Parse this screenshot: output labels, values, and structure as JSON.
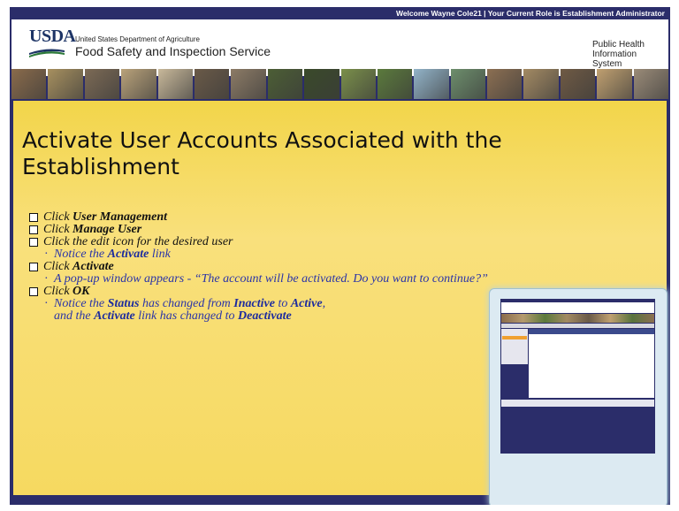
{
  "topbar": {
    "text": "Welcome Wayne Cole21  |  Your Current Role is Establishment Administrator"
  },
  "header": {
    "logo": "USDA",
    "department": "United States Department of Agriculture",
    "agency": "Food Safety and Inspection Service",
    "system_line1": "Public Health",
    "system_line2": "Information System"
  },
  "slide": {
    "title": "Activate User Accounts Associated with the Establishment",
    "steps": [
      {
        "prefix": "Click ",
        "bold": "User Management"
      },
      {
        "prefix": "Click ",
        "bold": "Manage User"
      },
      {
        "prefix": "Click the edit icon for the desired user"
      },
      {
        "sub1_a": "Notice the ",
        "sub1_b": "Activate",
        "sub1_c": " link"
      },
      {
        "prefix": "Click ",
        "bold": "Activate"
      },
      {
        "sub": "A pop-up window appears - “The account will be activated. Do you want to continue?”"
      },
      {
        "prefix": "Click ",
        "bold": "OK"
      },
      {
        "a": "Notice the ",
        "b": "Status",
        "c": " has changed from ",
        "d": "Inactive",
        "e": " to ",
        "f": "Active",
        "g": ",",
        "h": "and the ",
        "i": "Activate",
        "j": " link has changed to ",
        "k": "Deactivate"
      }
    ]
  },
  "colors": {
    "frame": "#2b2d6a",
    "content_bg": "#f7dc66",
    "sub_text": "#2a34a8"
  },
  "banner_photos": [
    "#8a6b4b",
    "#a7905f",
    "#7c6a55",
    "#b9a27a",
    "#c8b89a",
    "#6a5a48",
    "#8c7b66",
    "#4c5e35",
    "#3a4a2a",
    "#7a8f4a",
    "#5b7a3c",
    "#92b3c8",
    "#6d8e6c",
    "#8c6f52",
    "#a38a63",
    "#6f5a44",
    "#c0a070",
    "#9a8b78"
  ]
}
